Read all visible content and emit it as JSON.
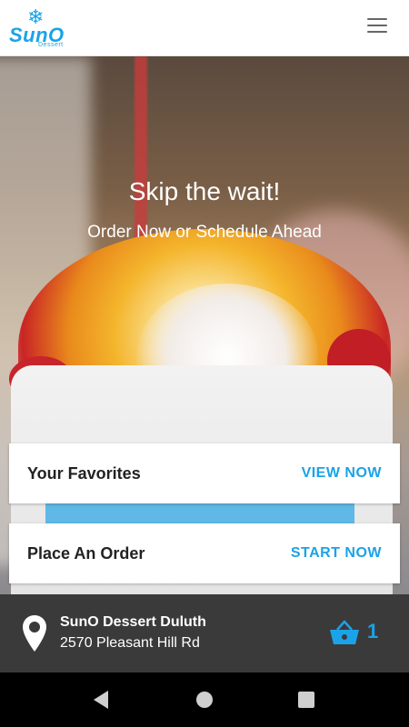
{
  "header": {
    "logo_text": "SunO",
    "logo_sub": "Dessert",
    "menu_icon": "hamburger-menu-icon"
  },
  "hero": {
    "title": "Skip the wait!",
    "subtitle": "Order Now or Schedule Ahead"
  },
  "cards": {
    "favorites": {
      "title": "Your Favorites",
      "action": "VIEW NOW"
    },
    "order": {
      "title": "Place An Order",
      "action": "START NOW"
    }
  },
  "store": {
    "name": "SunO Dessert Duluth",
    "address": "2570 Pleasant Hill Rd",
    "cart_count": "1",
    "accent": "#1aa3e8"
  },
  "navbar": {
    "icons": [
      "back-icon",
      "home-icon",
      "recent-apps-icon"
    ]
  }
}
